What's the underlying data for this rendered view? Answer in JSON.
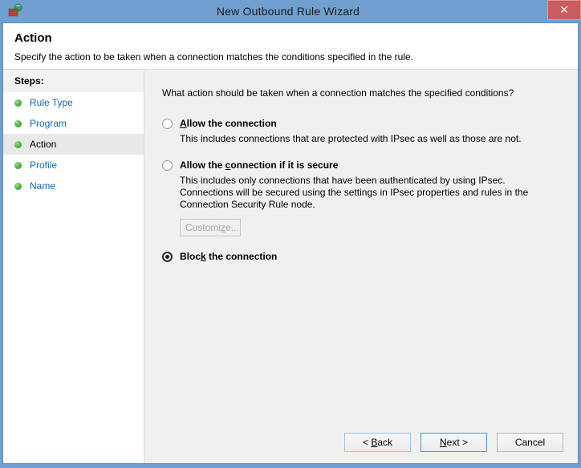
{
  "window": {
    "title": "New Outbound Rule Wizard",
    "app_icon": "firewall-globe-icon",
    "close_label": "✕",
    "titlebar_color": "#6fa0d0",
    "close_color": "#c95c5c"
  },
  "header": {
    "title": "Action",
    "subtitle": "Specify the action to be taken when a connection matches the conditions specified in the rule."
  },
  "sidebar": {
    "header": "Steps:",
    "items": [
      {
        "label": "Rule Type",
        "current": false
      },
      {
        "label": "Program",
        "current": false
      },
      {
        "label": "Action",
        "current": true
      },
      {
        "label": "Profile",
        "current": false
      },
      {
        "label": "Name",
        "current": false
      }
    ],
    "bullet_color": "#5cb84a",
    "link_color": "#1763ad"
  },
  "main": {
    "question": "What action should be taken when a connection matches the specified conditions?",
    "options": [
      {
        "id": "allow",
        "title_before": "",
        "title_accel": "A",
        "title_after": "llow the connection",
        "description": "This includes connections that are protected with IPsec as well as those are not.",
        "selected": false
      },
      {
        "id": "allow-if-secure",
        "title_before": "Allow the ",
        "title_accel": "c",
        "title_after": "onnection if it is secure",
        "description": "This includes only connections that have been authenticated by using IPsec.  Connections will be secured using the settings in IPsec properties and rules in the Connection Security Rule node.",
        "selected": false,
        "customize_button": {
          "label_before": "Customi",
          "label_accel": "z",
          "label_after": "e...",
          "disabled": true
        }
      },
      {
        "id": "block",
        "title_before": "Bloc",
        "title_accel": "k",
        "title_after": " the connection",
        "description": "",
        "selected": true
      }
    ]
  },
  "footer": {
    "buttons": [
      {
        "id": "back",
        "label_before": "< ",
        "label_accel": "B",
        "label_after": "ack",
        "style": "focus"
      },
      {
        "id": "next",
        "label_before": "",
        "label_accel": "N",
        "label_after": "ext >",
        "style": "default"
      },
      {
        "id": "cancel",
        "label_before": "Cancel",
        "label_accel": "",
        "label_after": "",
        "style": "normal"
      }
    ]
  }
}
